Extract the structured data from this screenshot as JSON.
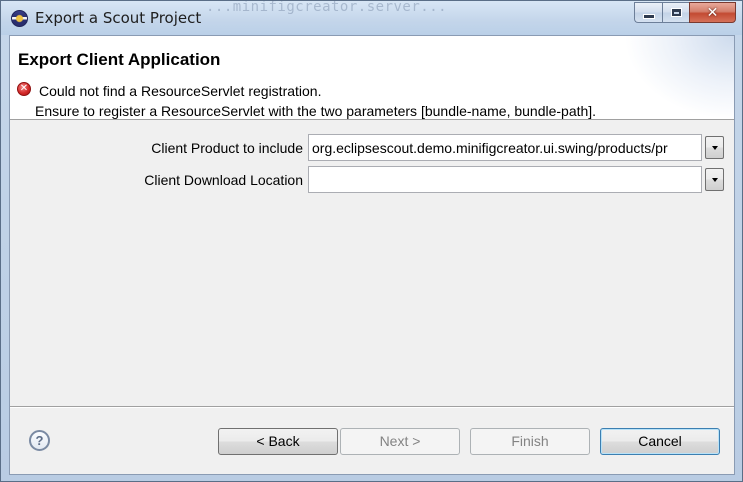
{
  "window": {
    "title": "Export a Scout Project",
    "background_text": "...minifigcreator.server..."
  },
  "header": {
    "title": "Export Client Application",
    "error_line1": "Could not find a ResourceServlet registration.",
    "error_line2": "Ensure to register a ResourceServlet with the two parameters [bundle-name, bundle-path]."
  },
  "form": {
    "client_product": {
      "label": "Client Product to include",
      "value": "org.eclipsescout.demo.minifigcreator.ui.swing/products/pr"
    },
    "download_location": {
      "label": "Client Download Location",
      "value": ""
    }
  },
  "buttons": {
    "back": "< Back",
    "next": "Next >",
    "finish": "Finish",
    "cancel": "Cancel"
  },
  "icons": {
    "title": "eclipse-icon",
    "error": "error-icon",
    "help": "help-icon"
  }
}
